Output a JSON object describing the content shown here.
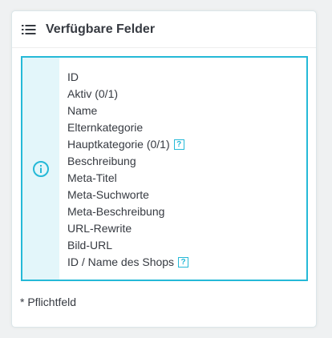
{
  "panel": {
    "title": "Verfügbare Felder",
    "icon": "list-icon"
  },
  "info": {
    "icon": "info-icon",
    "accent_color": "#25b9d7",
    "side_color": "#e3f6fa"
  },
  "fields": [
    {
      "label": "ID",
      "help": false
    },
    {
      "label": "Aktiv (0/1)",
      "help": false
    },
    {
      "label": "Name",
      "help": false
    },
    {
      "label": "Elternkategorie",
      "help": false
    },
    {
      "label": "Hauptkategorie (0/1)",
      "help": true
    },
    {
      "label": "Beschreibung",
      "help": false
    },
    {
      "label": "Meta-Titel",
      "help": false
    },
    {
      "label": "Meta-Suchworte",
      "help": false
    },
    {
      "label": "Meta-Beschreibung",
      "help": false
    },
    {
      "label": "URL-Rewrite",
      "help": false
    },
    {
      "label": "Bild-URL",
      "help": false
    },
    {
      "label": "ID / Name des Shops",
      "help": true
    }
  ],
  "help_badge_label": "?",
  "footnote": "* Pflichtfeld"
}
